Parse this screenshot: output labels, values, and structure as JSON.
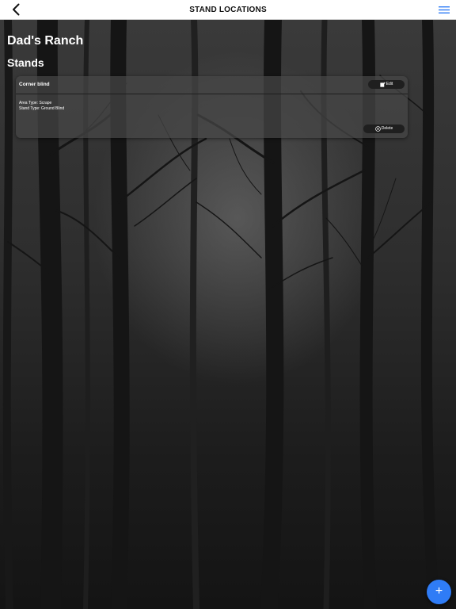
{
  "header": {
    "title": "STAND LOCATIONS",
    "back_icon": "chevron-left-icon",
    "menu_icon": "hamburger-menu-icon",
    "menu_color": "#2f7cf6"
  },
  "page": {
    "title": "Dad's Ranch",
    "section": "Stands"
  },
  "stands": [
    {
      "name": "Corner blind",
      "area_type": "Area Type: Scrape",
      "stand_type": "Stand Type: Ground Blind",
      "edit_label": "Edit",
      "delete_label": "Delete"
    }
  ],
  "fab": {
    "label": "+",
    "color": "#2f7cf6"
  }
}
